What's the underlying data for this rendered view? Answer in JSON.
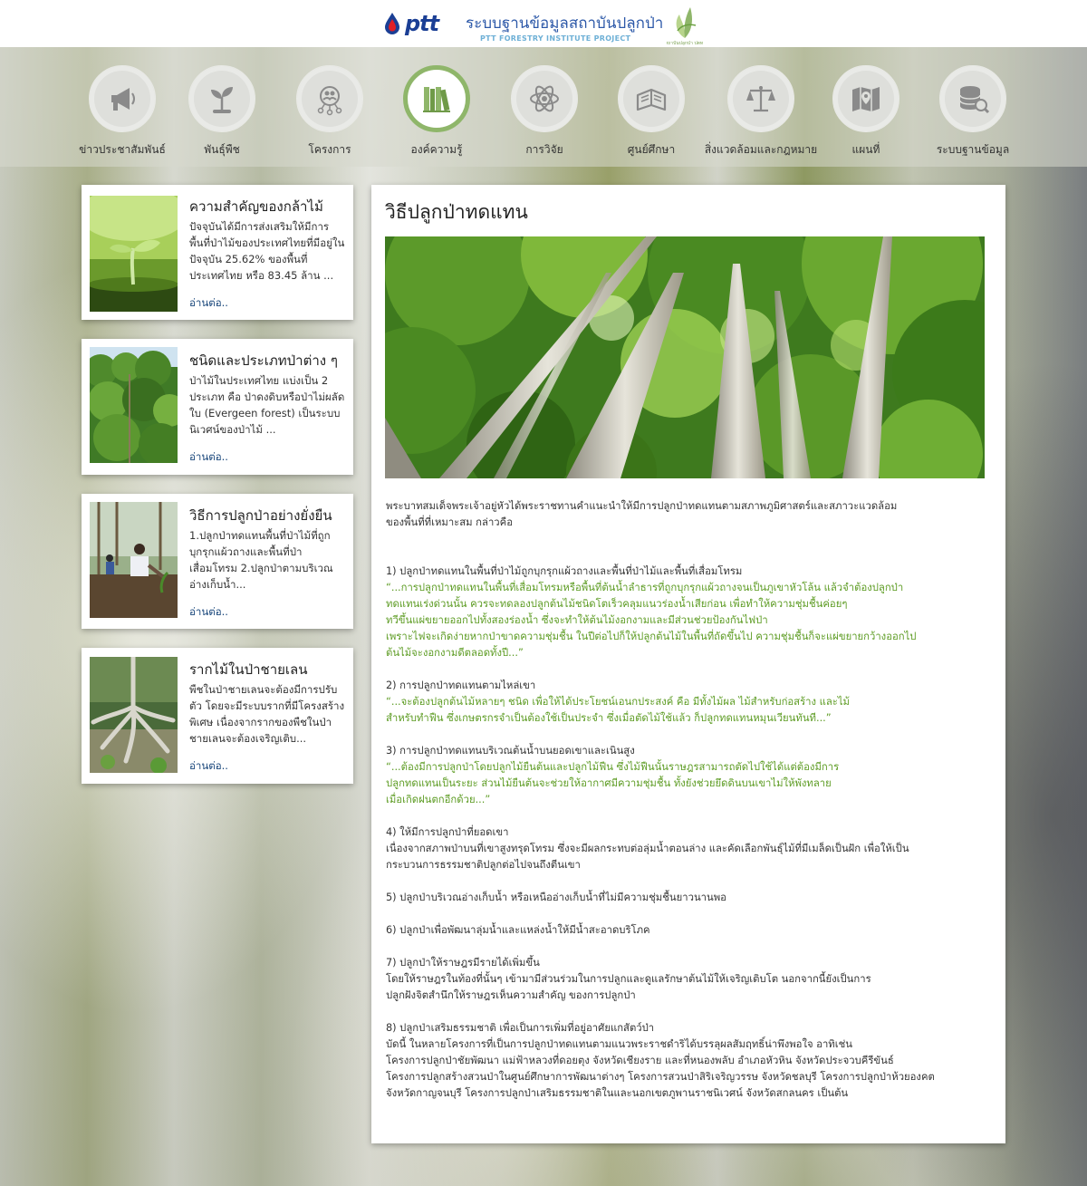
{
  "header": {
    "brand": "ptt",
    "site_title": "ระบบฐานข้อมูลสถาบันปลูกป่า",
    "site_subtitle": "PTT FORESTRY INSTITUTE PROJECT",
    "institute_logo_text": "สถาบันปลูกป่า ปตท."
  },
  "nav": [
    {
      "label": "ข่าวประชาสัมพันธ์",
      "icon": "megaphone-icon"
    },
    {
      "label": "พันธุ์พืช",
      "icon": "sprout-icon"
    },
    {
      "label": "โครงการ",
      "icon": "people-network-icon"
    },
    {
      "label": "องค์ความรู้",
      "icon": "books-icon",
      "active": true
    },
    {
      "label": "การวิจัย",
      "icon": "atom-icon"
    },
    {
      "label": "ศูนย์ศึกษา",
      "icon": "open-book-icon"
    },
    {
      "label": "สิ่งแวดล้อมและกฎหมาย",
      "icon": "scales-icon"
    },
    {
      "label": "แผนที่",
      "icon": "map-pin-icon"
    },
    {
      "label": "ระบบฐานข้อมูล",
      "icon": "database-search-icon"
    }
  ],
  "cards": [
    {
      "title": "ความสำคัญของกล้าไม้",
      "text": "ปัจจุบันได้มีการส่งเสริมให้มีการพื้นที่ป่าไม้ของประเทศไทยที่มีอยู่ในปัจจุบัน 25.62% ของพื้นที่ประเทศไทย หรือ 83.45 ล้าน ...",
      "more": "อ่านต่อ.."
    },
    {
      "title": "ชนิดและประเภทป่าต่าง ๆ",
      "text": "ป่าไม้ในประเทศไทย แบ่งเป็น 2 ประเภท คือ ป่าดงดิบหรือป่าไม่ผลัดใบ (Evergeen forest) เป็นระบบนิเวศน์ของป่าไม้ ...",
      "more": "อ่านต่อ.."
    },
    {
      "title": "วิธีการปลูกป่าอย่างยั่งยืน",
      "text": "1.ปลูกป่าทดแทนพื้นที่ป่าไม้ที่ถูกบุกรุกแผ้วถางและพื้นที่ป่าเสื่อมโทรม 2.ปลูกป่าตามบริเวณอ่างเก็บน้ำ...",
      "more": "อ่านต่อ.."
    },
    {
      "title": "รากไม้ในป่าชายเลน",
      "text": "พืชในป่าชายเลนจะต้องมีการปรับตัว โดยจะมีระบบรากที่มีโครงสร้างพิเศษ เนื่องจากรากของพืชในป่าชายเลนจะต้องเจริญเติบ...",
      "more": "อ่านต่อ.."
    }
  ],
  "article": {
    "title": "วิธีปลูกป่าทดแทน",
    "intro": [
      "พระบาทสมเด็จพระเจ้าอยู่หัวได้พระราชทานคำแนะนำให้มีการปลูกป่าทดแทนตามสภาพภูมิศาสตร์และสภาวะแวดล้อม",
      "ของพื้นที่ที่เหมาะสม กล่าวคือ"
    ],
    "s1_head": "1) ปลูกป่าทดแทนในพื้นที่ป่าไม้ถูกบุกรุกแผ้วถางและพื้นที่ป่าไม้และพื้นที่เสื่อมโทรม",
    "s1_quote": [
      "“...การปลูกป่าทดแทนในพื้นที่เสื่อมโทรมหรือพื้นที่ต้นน้ำลำธารที่ถูกบุกรุกแผ้วถางจนเป็นภูเขาหัวโล้น แล้วจำต้องปลูกป่า",
      "ทดแทนเร่งด่วนนั้น ควรจะทดลองปลูกต้นไม้ชนิดโตเร็วคลุมแนวร่องน้ำเสียก่อน เพื่อทำให้ความชุ่มชื้นค่อยๆ",
      "ทวีขึ้นแผ่ขยายออกไปทั้งสองร่องน้ำ ซึ่งจะทำให้ต้นไม้งอกงามและมีส่วนช่วยป้องกันไฟป่า",
      "เพราะไฟจะเกิดง่ายหากป่าขาดความชุ่มชื้น ในปีต่อไปก็ให้ปลูกต้นไม้ในพื้นที่ถัดขึ้นไป ความชุ่มชื้นก็จะแผ่ขยายกว้างออกไป",
      "ต้นไม้จะงอกงามดีตลอดทั้งปี...”"
    ],
    "s2_head": "2) การปลูกป่าทดแทนตามไหล่เขา",
    "s2_quote": [
      "“...จะต้องปลูกต้นไม้หลายๆ ชนิด เพื่อให้ได้ประโยชน์เอนกประสงค์ คือ มีทั้งไม้ผล ไม้สำหรับก่อสร้าง และไม้",
      "สำหรับทำฟืน ซึ่งเกษตรกรจำเป็นต้องใช้เป็นประจำ ซึ่งเมื่อตัดไม้ใช้แล้ว ก็ปลูกทดแทนหมุนเวียนทันที...”"
    ],
    "s3_head": "3) การปลูกป่าทดแทนบริเวณต้นน้ำบนยอดเขาและเนินสูง",
    "s3_quote": [
      "“...ต้องมีการปลูกป่าโดยปลูกไม้ยืนต้นและปลูกไม้ฟืน ซึ่งไม้ฟืนนั้นราษฎรสามารถตัดไปใช้ได้แต่ต้องมีการ",
      "ปลูกทดแทนเป็นระยะ ส่วนไม้ยืนต้นจะช่วยให้อากาศมีความชุ่มชื้น ทั้งยังช่วยยึดดินบนเขาไม่ให้พังทลาย",
      "เมื่อเกิดฝนตกอีกด้วย...”"
    ],
    "s4_head": "4) ให้มีการปลูกป่าที่ยอดเขา",
    "s4_text": [
      "เนื่องจากสภาพป่าบนที่เขาสูงทรุดโทรม ซึ่งจะมีผลกระทบต่อลุ่มน้ำตอนล่าง และคัดเลือกพันธุ์ไม้ที่มีเมล็ดเป็นฝัก เพื่อให้เป็น",
      "กระบวนการธรรมชาติปลูกต่อไปจนถึงตีนเขา"
    ],
    "s5_head": "5) ปลูกป่าบริเวณอ่างเก็บน้ำ หรือเหนืออ่างเก็บน้ำที่ไม่มีความชุ่มชื้นยาวนานพอ",
    "s6_head": "6) ปลูกป่าเพื่อพัฒนาลุ่มน้ำและแหล่งน้ำให้มีน้ำสะอาดบริโภค",
    "s7_head": "7) ปลูกป่าให้ราษฎรมีรายได้เพิ่มขึ้น",
    "s7_text": [
      "โดยให้ราษฎรในท้องที่นั้นๆ เข้ามามีส่วนร่วมในการปลูกและดูแลรักษาต้นไม้ให้เจริญเติบโต นอกจากนี้ยังเป็นการ",
      "ปลูกฝังจิตสำนึกให้ราษฎรเห็นความสำคัญ ของการปลูกป่า"
    ],
    "s8_head": "8) ปลูกป่าเสริมธรรมชาติ เพื่อเป็นการเพิ่มที่อยู่อาศัยแกสัตว์ป่า",
    "s8_text": [
      "บัดนี้ ในหลายโครงการที่เป็นการปลูกป่าทดแทนตามแนวพระราชดำริได้บรรลุผลสัมฤทธิ์น่าพึงพอใจ อาทิเช่น",
      "โครงการปลูกป่าชัยพัฒนา แม่ฟ้าหลวงที่ดอยตุง จังหวัดเชียงราย และที่หนองพลับ อำเภอหัวหิน จังหวัดประจวบคีรีขันธ์",
      "โครงการปลูกสร้างสวนป่าในศูนย์ศึกษาการพัฒนาต่างๆ โครงการสวนป่าสิริเจริญวรรษ จังหวัดชลบุรี โครงการปลูกป่าห้วยองคต",
      "จังหวัดกาญจนบุรี โครงการปลูกป่าเสริมธรรมชาติในและนอกเขตภูพานราชนิเวศน์ จังหวัดสกลนคร เป็นต้น"
    ]
  },
  "colors": {
    "accent_green": "#8fb66a",
    "quote_green": "#5c9b22",
    "title_blue": "#2c58a8",
    "link_blue": "#17457a"
  }
}
